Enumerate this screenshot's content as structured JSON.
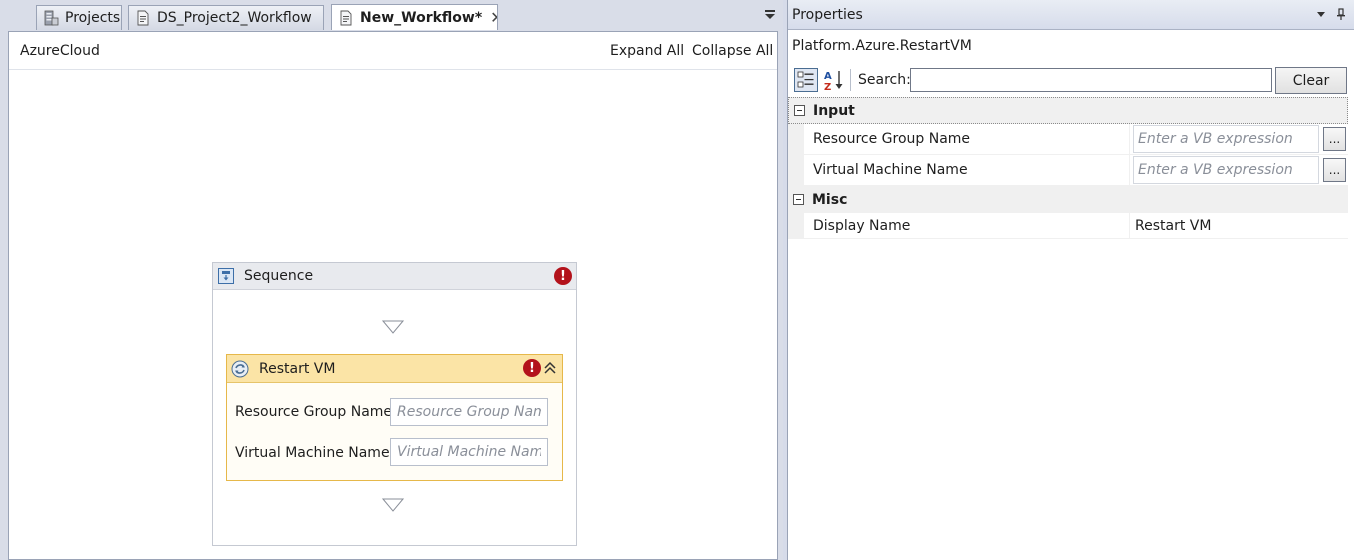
{
  "tabs": [
    {
      "label": "Projects",
      "icon": "projects-icon"
    },
    {
      "label": "DS_Project2_Workflow",
      "icon": "workflow-doc-icon"
    },
    {
      "label": "New_Workflow*",
      "icon": "workflow-doc-icon",
      "active": true
    }
  ],
  "designer": {
    "breadcrumb": "AzureCloud",
    "expand_all": "Expand All",
    "collapse_all": "Collapse All",
    "sequence": {
      "title": "Sequence",
      "error_glyph": "!",
      "activity": {
        "title": "Restart VM",
        "error_glyph": "!",
        "fields": [
          {
            "label": "Resource Group Name",
            "placeholder": "Resource Group Name"
          },
          {
            "label": "Virtual Machine Name",
            "placeholder": "Virtual Machine Name"
          }
        ]
      }
    }
  },
  "properties": {
    "title": "Properties",
    "selected_type": "Platform.Azure.RestartVM",
    "search_label": "Search:",
    "search_value": "",
    "clear_label": "Clear",
    "categories": [
      {
        "name": "Input",
        "rows": [
          {
            "name": "Resource Group Name",
            "placeholder": "Enter a VB expression",
            "button": "..."
          },
          {
            "name": "Virtual Machine Name",
            "placeholder": "Enter a VB expression",
            "button": "..."
          }
        ]
      },
      {
        "name": "Misc",
        "rows": [
          {
            "name": "Display Name",
            "value": "Restart VM"
          }
        ]
      }
    ]
  },
  "colors": {
    "error": "#b3121b",
    "activity_header": "#fbe4a6",
    "activity_border": "#e6b84a",
    "sequence_header": "#e8eaee",
    "panel_header": "#d6dceb"
  }
}
